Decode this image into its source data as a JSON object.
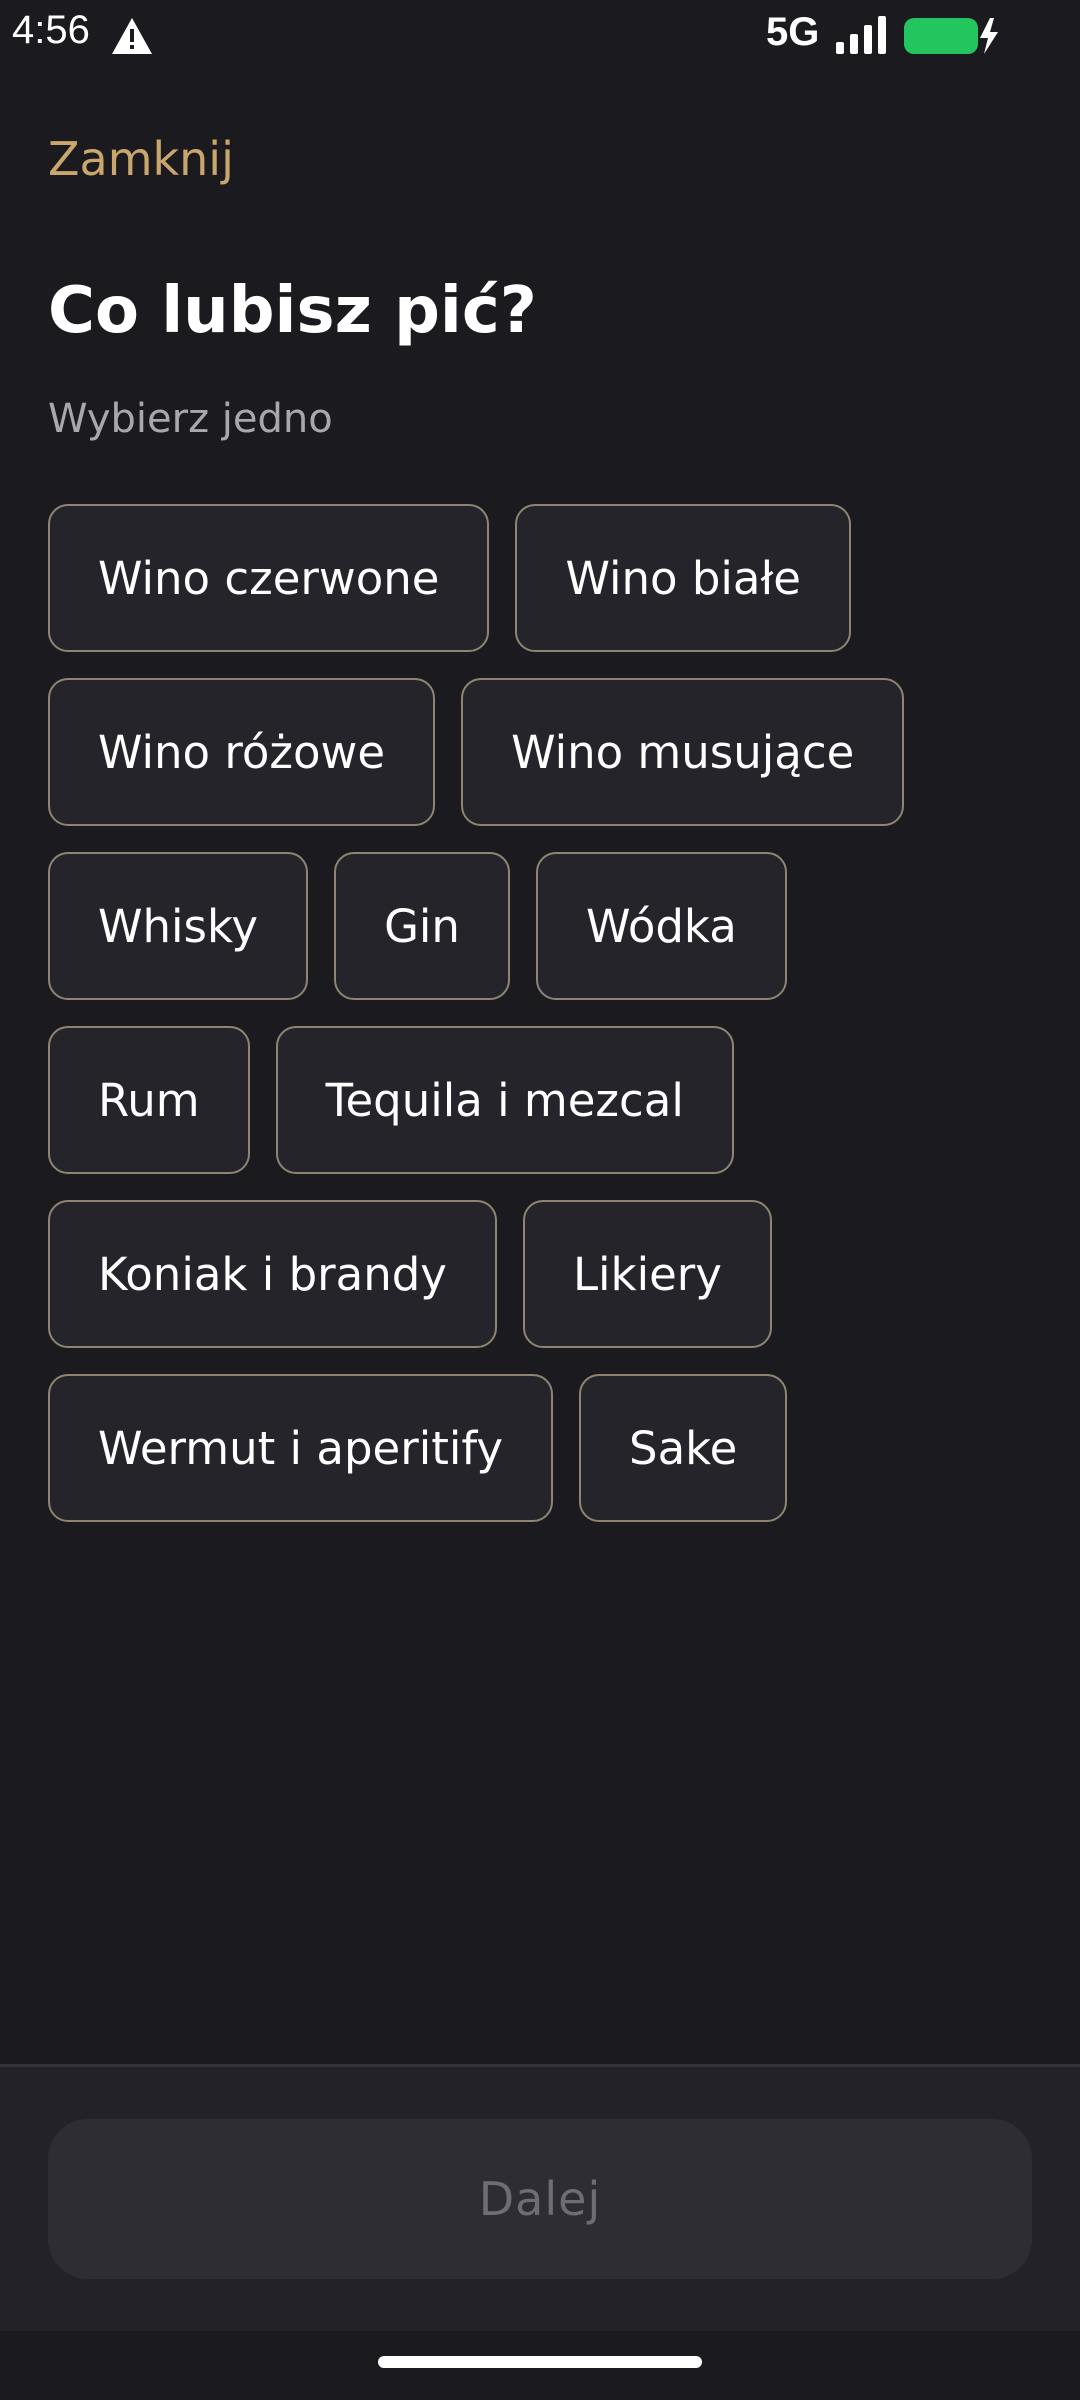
{
  "status_bar": {
    "time": "4:56",
    "network": "5G",
    "icons": [
      "warning-icon",
      "signal-icon",
      "battery-charging-icon"
    ],
    "battery_color": "#22c55e"
  },
  "header": {
    "close_label": "Zamknij"
  },
  "main": {
    "title": "Co lubisz pić?",
    "subtitle": "Wybierz jedno",
    "options": [
      "Wino czerwone",
      "Wino białe",
      "Wino różowe",
      "Wino musujące",
      "Whisky",
      "Gin",
      "Wódka",
      "Rum",
      "Tequila i mezcal",
      "Koniak i brandy",
      "Likiery",
      "Wermut i aperitify",
      "Sake"
    ]
  },
  "footer": {
    "next_label": "Dalej"
  },
  "colors": {
    "accent": "#c9a66b",
    "background": "#1b1a1f",
    "chip_border": "#8e8472",
    "disabled_text": "#6e6d73"
  }
}
